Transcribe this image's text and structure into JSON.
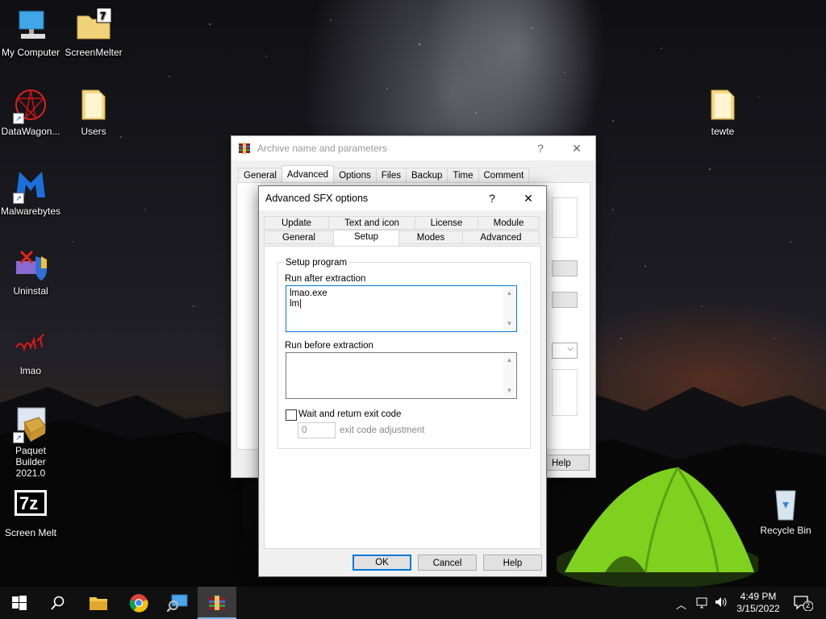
{
  "desktop": {
    "icons": [
      {
        "label": "My Computer",
        "icon": "computer-icon"
      },
      {
        "label": "ScreenMelter",
        "icon": "folder-7z-icon"
      },
      {
        "label": "DataWagon...",
        "icon": "datawagon-icon"
      },
      {
        "label": "Users",
        "icon": "folder-icon"
      },
      {
        "label": "Malwarebytes",
        "icon": "malwarebytes-icon"
      },
      {
        "label": "Uninstal",
        "icon": "uninstall-shield-icon"
      },
      {
        "label": "lmao",
        "icon": "lmao-icon"
      },
      {
        "label": "Paquet Builder 2021.0",
        "line1": "Paquet",
        "line2": "Builder 2021.0",
        "icon": "paquet-builder-icon"
      },
      {
        "label": "Screen Melt",
        "icon": "7z-icon"
      },
      {
        "label": "tewte",
        "icon": "folder-icon"
      },
      {
        "label": "Recycle Bin",
        "icon": "recycle-bin-icon"
      }
    ]
  },
  "back_window": {
    "title": "Archive name and parameters",
    "help_symbol": "?",
    "close_symbol": "✕",
    "tabs": [
      "General",
      "Advanced",
      "Options",
      "Files",
      "Backup",
      "Time",
      "Comment"
    ],
    "active_tab": "Advanced",
    "help_button": "Help"
  },
  "dialog": {
    "title": "Advanced SFX options",
    "help_symbol": "?",
    "close_symbol": "✕",
    "tabs_row1": [
      "Update",
      "Text and icon",
      "License",
      "Module"
    ],
    "tabs_row2": [
      "General",
      "Setup",
      "Modes",
      "Advanced"
    ],
    "active_tab": "Setup",
    "group_label": "Setup program",
    "run_after_label": "Run after extraction",
    "run_after_value": "lmao.exe\nlm",
    "run_before_label": "Run before extraction",
    "run_before_value": "",
    "wait_checkbox_label": "Wait and return exit code",
    "wait_checked": false,
    "exit_code_value": "0",
    "exit_code_label": "exit code adjustment",
    "buttons": {
      "ok": "OK",
      "cancel": "Cancel",
      "help": "Help"
    }
  },
  "taskbar": {
    "items": [
      "start-icon",
      "search-icon",
      "file-explorer-icon",
      "chrome-icon",
      "remote-desktop-icon",
      "winrar-icon"
    ],
    "active_item": "winrar-icon",
    "time": "4:49 PM",
    "date": "3/15/2022",
    "notification_count": "2"
  }
}
